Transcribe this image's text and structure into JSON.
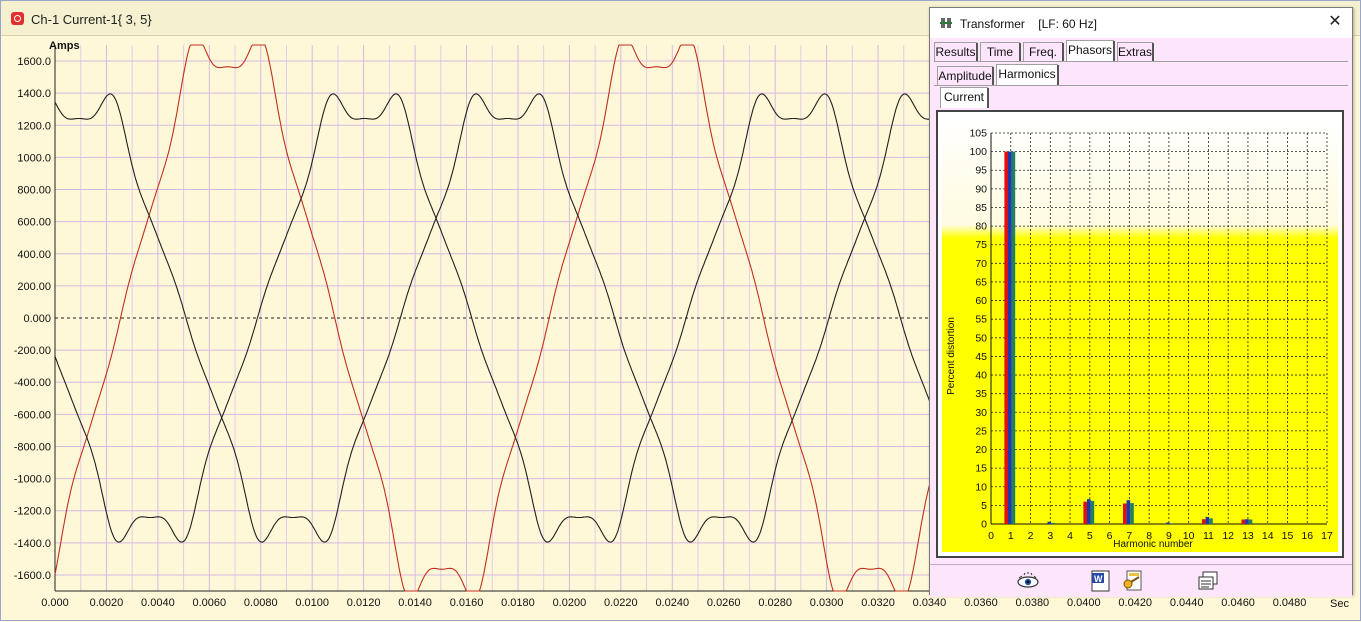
{
  "main": {
    "title": "Ch-1 Current-1{ 3, 5}",
    "ylabel": "Amps",
    "xlabel": "Sec"
  },
  "dialog": {
    "title": "Transformer    [LF: 60 Hz]",
    "icon": "transformer-icon",
    "tabs_row1": [
      {
        "label": "Results",
        "active": false
      },
      {
        "label": "Time",
        "active": false
      },
      {
        "label": "Freq.",
        "active": false
      },
      {
        "label": "Phasors",
        "active": true
      },
      {
        "label": "Extras",
        "active": false
      }
    ],
    "tabs_row2": [
      {
        "label": "Amplitude",
        "active": false
      },
      {
        "label": "Harmonics",
        "active": true
      }
    ],
    "tabs_row3": [
      {
        "label": "Current",
        "active": true
      }
    ],
    "toolbar": [
      "eye-icon",
      "word-document-icon",
      "settings-key-icon",
      "copy-windows-icon"
    ]
  },
  "chart_data": [
    {
      "type": "line",
      "title": "",
      "ylabel": "Amps",
      "xlabel": "Sec",
      "xlim": [
        0,
        0.05
      ],
      "ylim": [
        -1700,
        1700
      ],
      "grid": true,
      "xticks": [
        "0.000",
        "0.0020",
        "0.0040",
        "0.0060",
        "0.0080",
        "0.0100",
        "0.0120",
        "0.0140",
        "0.0160",
        "0.0180",
        "0.0200",
        "0.0220",
        "0.0240",
        "0.0260",
        "0.0280",
        "0.0300",
        "0.0320",
        "0.0340",
        "0.0360",
        "0.0380",
        "0.0400",
        "0.0420",
        "0.0440",
        "0.0460",
        "0.0480"
      ],
      "yticks": [
        "1600.0",
        "1400.0",
        "1200.0",
        "1000.0",
        "800.00",
        "600.00",
        "400.00",
        "200.00",
        "0.000",
        "-200.00",
        "-400.00",
        "-600.00",
        "-800.00",
        "-1000.0",
        "-1200.0",
        "-1400.0",
        "-1600.0"
      ],
      "waveform": {
        "fundamental_hz": 60,
        "amplitude": 1320,
        "h5_fraction": 0.065,
        "h7_fraction": 0.06,
        "h11_fraction": 0.018,
        "h13_fraction": 0.014
      },
      "series": [
        {
          "color": "#c03020",
          "phase_deg": -55,
          "peak_amps": 1725
        },
        {
          "color": "#202020",
          "phase_deg": 70,
          "peak_amps": 1370
        },
        {
          "color": "#202020",
          "phase_deg": 190,
          "peak_amps": 1370
        }
      ]
    },
    {
      "type": "bar",
      "title": "",
      "ylabel": "Percent distortion",
      "xlabel": "Harmonic number",
      "ylim": [
        0,
        105
      ],
      "xlim": [
        0,
        17
      ],
      "yticks": [
        0,
        5,
        10,
        15,
        20,
        25,
        30,
        35,
        40,
        45,
        50,
        55,
        60,
        65,
        70,
        75,
        80,
        85,
        90,
        95,
        100,
        105
      ],
      "xticks": [
        0,
        1,
        2,
        3,
        4,
        5,
        6,
        7,
        8,
        9,
        10,
        11,
        12,
        13,
        14,
        15,
        16,
        17
      ],
      "grid": true,
      "series": [
        {
          "color": "#e01010",
          "harmonics": [
            1,
            3,
            5,
            7,
            9,
            11,
            13
          ],
          "values": [
            100,
            0,
            6,
            5.5,
            0,
            1.3,
            1.2
          ]
        },
        {
          "color": "#1a3ab0",
          "harmonics": [
            1,
            3,
            5,
            7,
            9,
            11,
            13
          ],
          "values": [
            100,
            0.6,
            6.7,
            6.4,
            0.4,
            1.9,
            1.3
          ]
        },
        {
          "color": "#208060",
          "harmonics": [
            1,
            3,
            5,
            7,
            9,
            11,
            13
          ],
          "values": [
            100,
            0.3,
            6.2,
            5.6,
            0.2,
            1.5,
            1.2
          ]
        }
      ]
    }
  ]
}
